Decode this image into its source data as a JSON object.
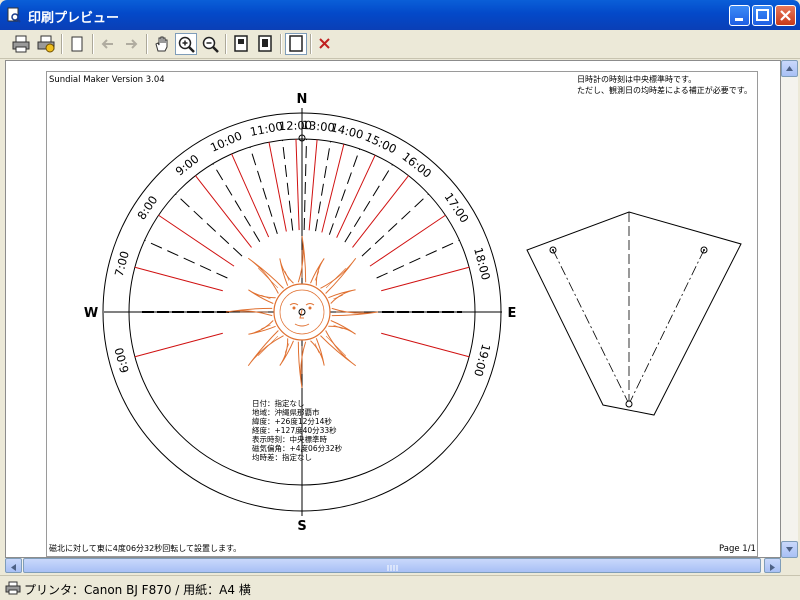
{
  "window": {
    "title": "印刷プレビュー"
  },
  "toolbar": {
    "print": "printer-icon",
    "print_setup": "printer-setup-icon",
    "page": "page-icon",
    "back": "arrow-left-icon",
    "forward": "arrow-right-icon",
    "hand": "hand-icon",
    "zoom_in": "zoom-in-icon",
    "zoom_out": "zoom-out-icon",
    "close": "close-icon"
  },
  "paper": {
    "app_version": "Sundial Maker Version 3.04",
    "notice_line1": "日時計の時刻は中央標準時です。",
    "notice_line2": "ただし、観測日の均時差による補正が必要です。",
    "footer_note": "磁北に対して東に4度06分32秒回転して設置します。",
    "page_label": "Page 1/1"
  },
  "compass": {
    "north": "N",
    "south": "S",
    "east": "E",
    "west": "W"
  },
  "hours": [
    {
      "label": "6:00",
      "angle": -105
    },
    {
      "label": "7:00",
      "angle": -75
    },
    {
      "label": "8:00",
      "angle": -56
    },
    {
      "label": "9:00",
      "angle": -38
    },
    {
      "label": "10:00",
      "angle": -24
    },
    {
      "label": "11:00",
      "angle": -11
    },
    {
      "label": "12:00",
      "angle": -2
    },
    {
      "label": "13:00",
      "angle": 5
    },
    {
      "label": "14:00",
      "angle": 14
    },
    {
      "label": "15:00",
      "angle": 25
    },
    {
      "label": "16:00",
      "angle": 38
    },
    {
      "label": "17:00",
      "angle": 56
    },
    {
      "label": "18:00",
      "angle": 75
    },
    {
      "label": "19:00",
      "angle": 105
    }
  ],
  "info": {
    "line1": "日付：指定なし",
    "line2": "地域：沖縄県那覇市",
    "line3": "緯度：+26度12分14秒",
    "line4": "経度：+127度40分33秒",
    "line5": "表示時刻：中央標準時",
    "line6": "磁気偏角：+4度06分32秒",
    "line7": "均時差：指定なし"
  },
  "statusbar": {
    "text": "プリンタ：Canon BJ F870 / 用紙：A4 横"
  },
  "colors": {
    "hour_line": "#d01010",
    "sun": "#e07030",
    "title_blue": "#0a4fd0"
  }
}
